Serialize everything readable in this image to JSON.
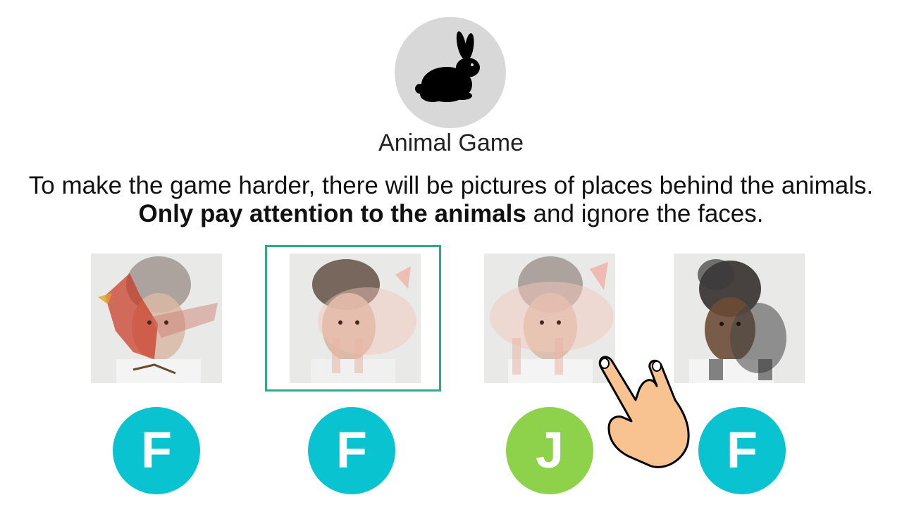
{
  "game": {
    "title": "Animal Game",
    "icon": "rabbit-icon"
  },
  "instructions": {
    "part1": "To make the game harder, there will be pictures of places behind the animals.",
    "bold": "Only pay attention to the animals",
    "part2": "and ignore the faces."
  },
  "trials": [
    {
      "animal": "cardinal",
      "face": "woman-curly-hair",
      "key": "F",
      "key_color": "#09c3d0"
    },
    {
      "animal": "pig",
      "face": "young-man",
      "key": "F",
      "key_color": "#09c3d0",
      "selected": true
    },
    {
      "animal": "pig",
      "face": "woman-curly-hair",
      "key": "J",
      "key_color": "#8ed14a"
    },
    {
      "animal": "dog",
      "face": "woman-dark-hair",
      "key": "F",
      "key_color": "#09c3d0"
    }
  ],
  "pointer": "pointing-hand-icon",
  "colors": {
    "selection": "#2daa86",
    "key_f": "#09c3d0",
    "key_j": "#8ed14a"
  }
}
